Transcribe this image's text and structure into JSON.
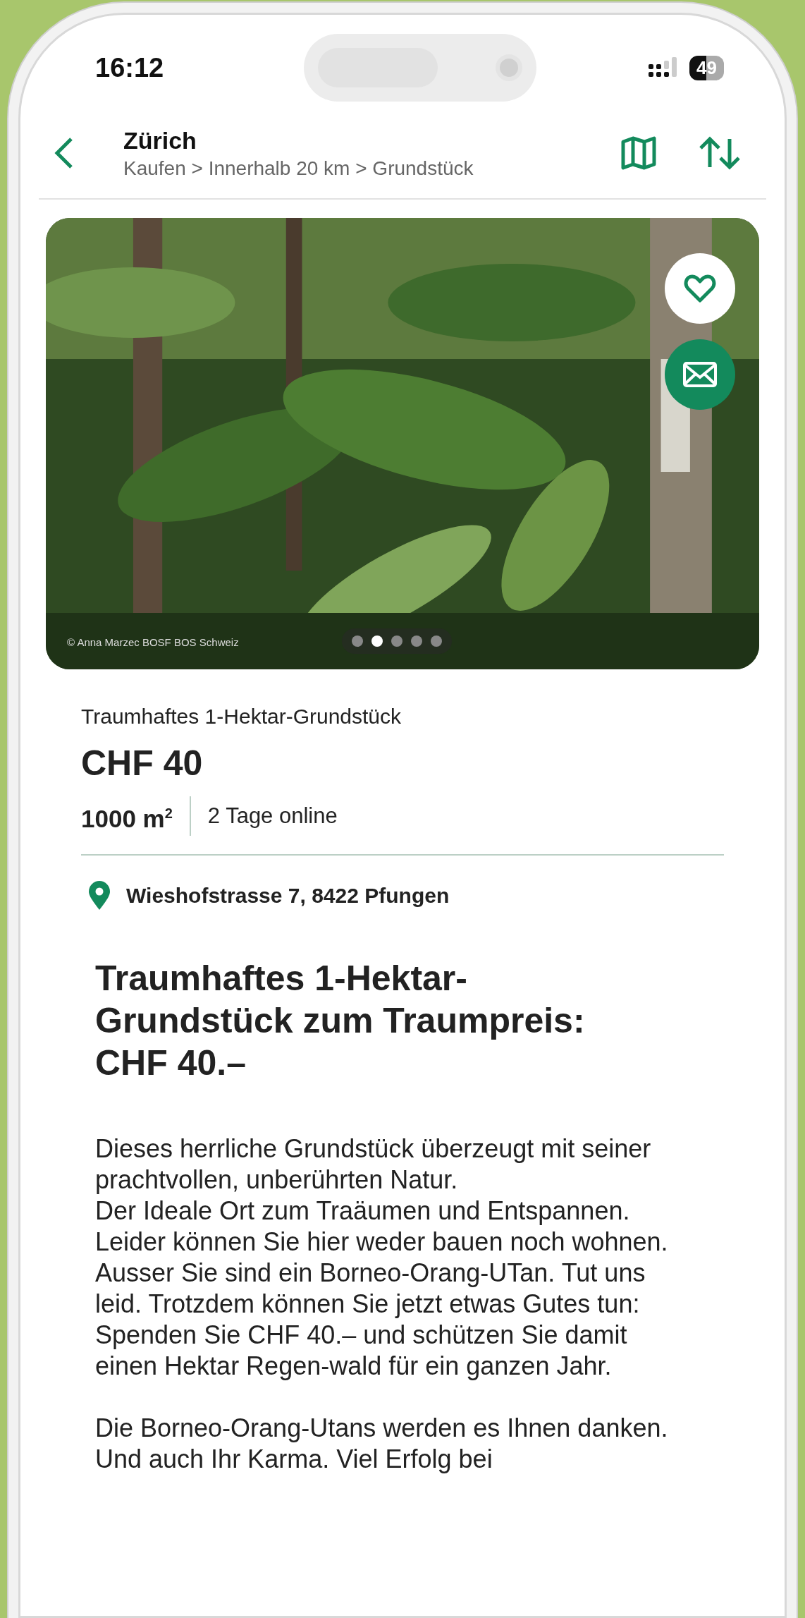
{
  "status_bar": {
    "time": "16:12",
    "battery": "49"
  },
  "header": {
    "title": "Zürich",
    "breadcrumb": "Kaufen > Innerhalb 20 km > Grundstück"
  },
  "gallery": {
    "credit": "© Anna Marzec BOSF BOS Schweiz",
    "dots": [
      {
        "selected": false
      },
      {
        "selected": true
      },
      {
        "selected": false
      },
      {
        "selected": false
      },
      {
        "selected": false
      }
    ]
  },
  "listing": {
    "name": "Traumhaftes 1-Hektar-Grundstück",
    "price": "CHF 40",
    "area": "1000 m$^{2}$",
    "online": "2 Tage online",
    "address": "Wieshofstrasse 7, 8422 Pfungen"
  },
  "description": {
    "heading": "Traumhaftes 1-Hektar-\nGrundstück zum Traumpreis:\nCHF 40.–",
    "paragraphs": [
      "Dieses herrliche Grundstück überzeugt mit seiner prachtvollen, unberührten Natur.\nDer Ideale Ort zum Traäumen und Entspannen. Leider können Sie hier weder bauen noch wohnen. Ausser Sie sind ein Borneo-Orang-UTan. Tut uns leid. Trotzdem können Sie jetzt etwas Gutes tun: Spenden Sie CHF 40.– und schützen Sie damit einen Hektar Regen-wald für ein ganzen Jahr.",
      "Die Borneo-Orang-Utans werden es Ihnen danken. Und auch Ihr Karma. Viel Erfolg bei"
    ]
  }
}
